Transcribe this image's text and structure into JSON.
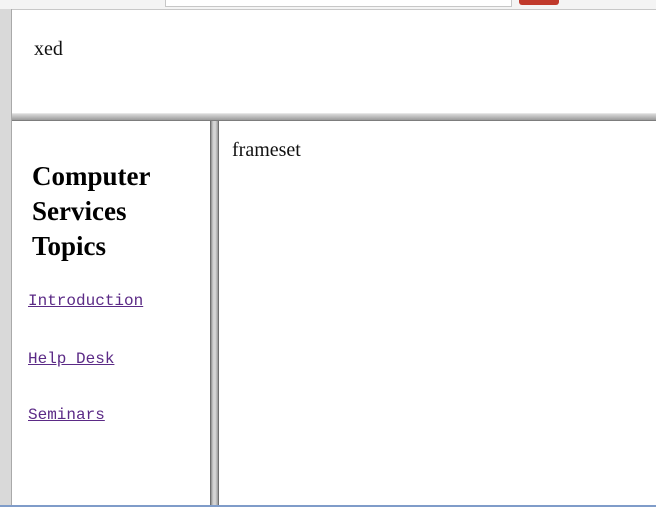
{
  "top_frame": {
    "text": "xed"
  },
  "navigation": {
    "heading": "Computer Services Topics",
    "links": [
      {
        "label": "Introduction"
      },
      {
        "label": "Help Desk"
      },
      {
        "label": "Seminars"
      }
    ],
    "link_color": "#5b2a86"
  },
  "main_frame": {
    "text": "frameset"
  },
  "colors": {
    "splitter": "#bdbdbd",
    "background": "#ffffff",
    "accent_button": "#c0392b"
  }
}
